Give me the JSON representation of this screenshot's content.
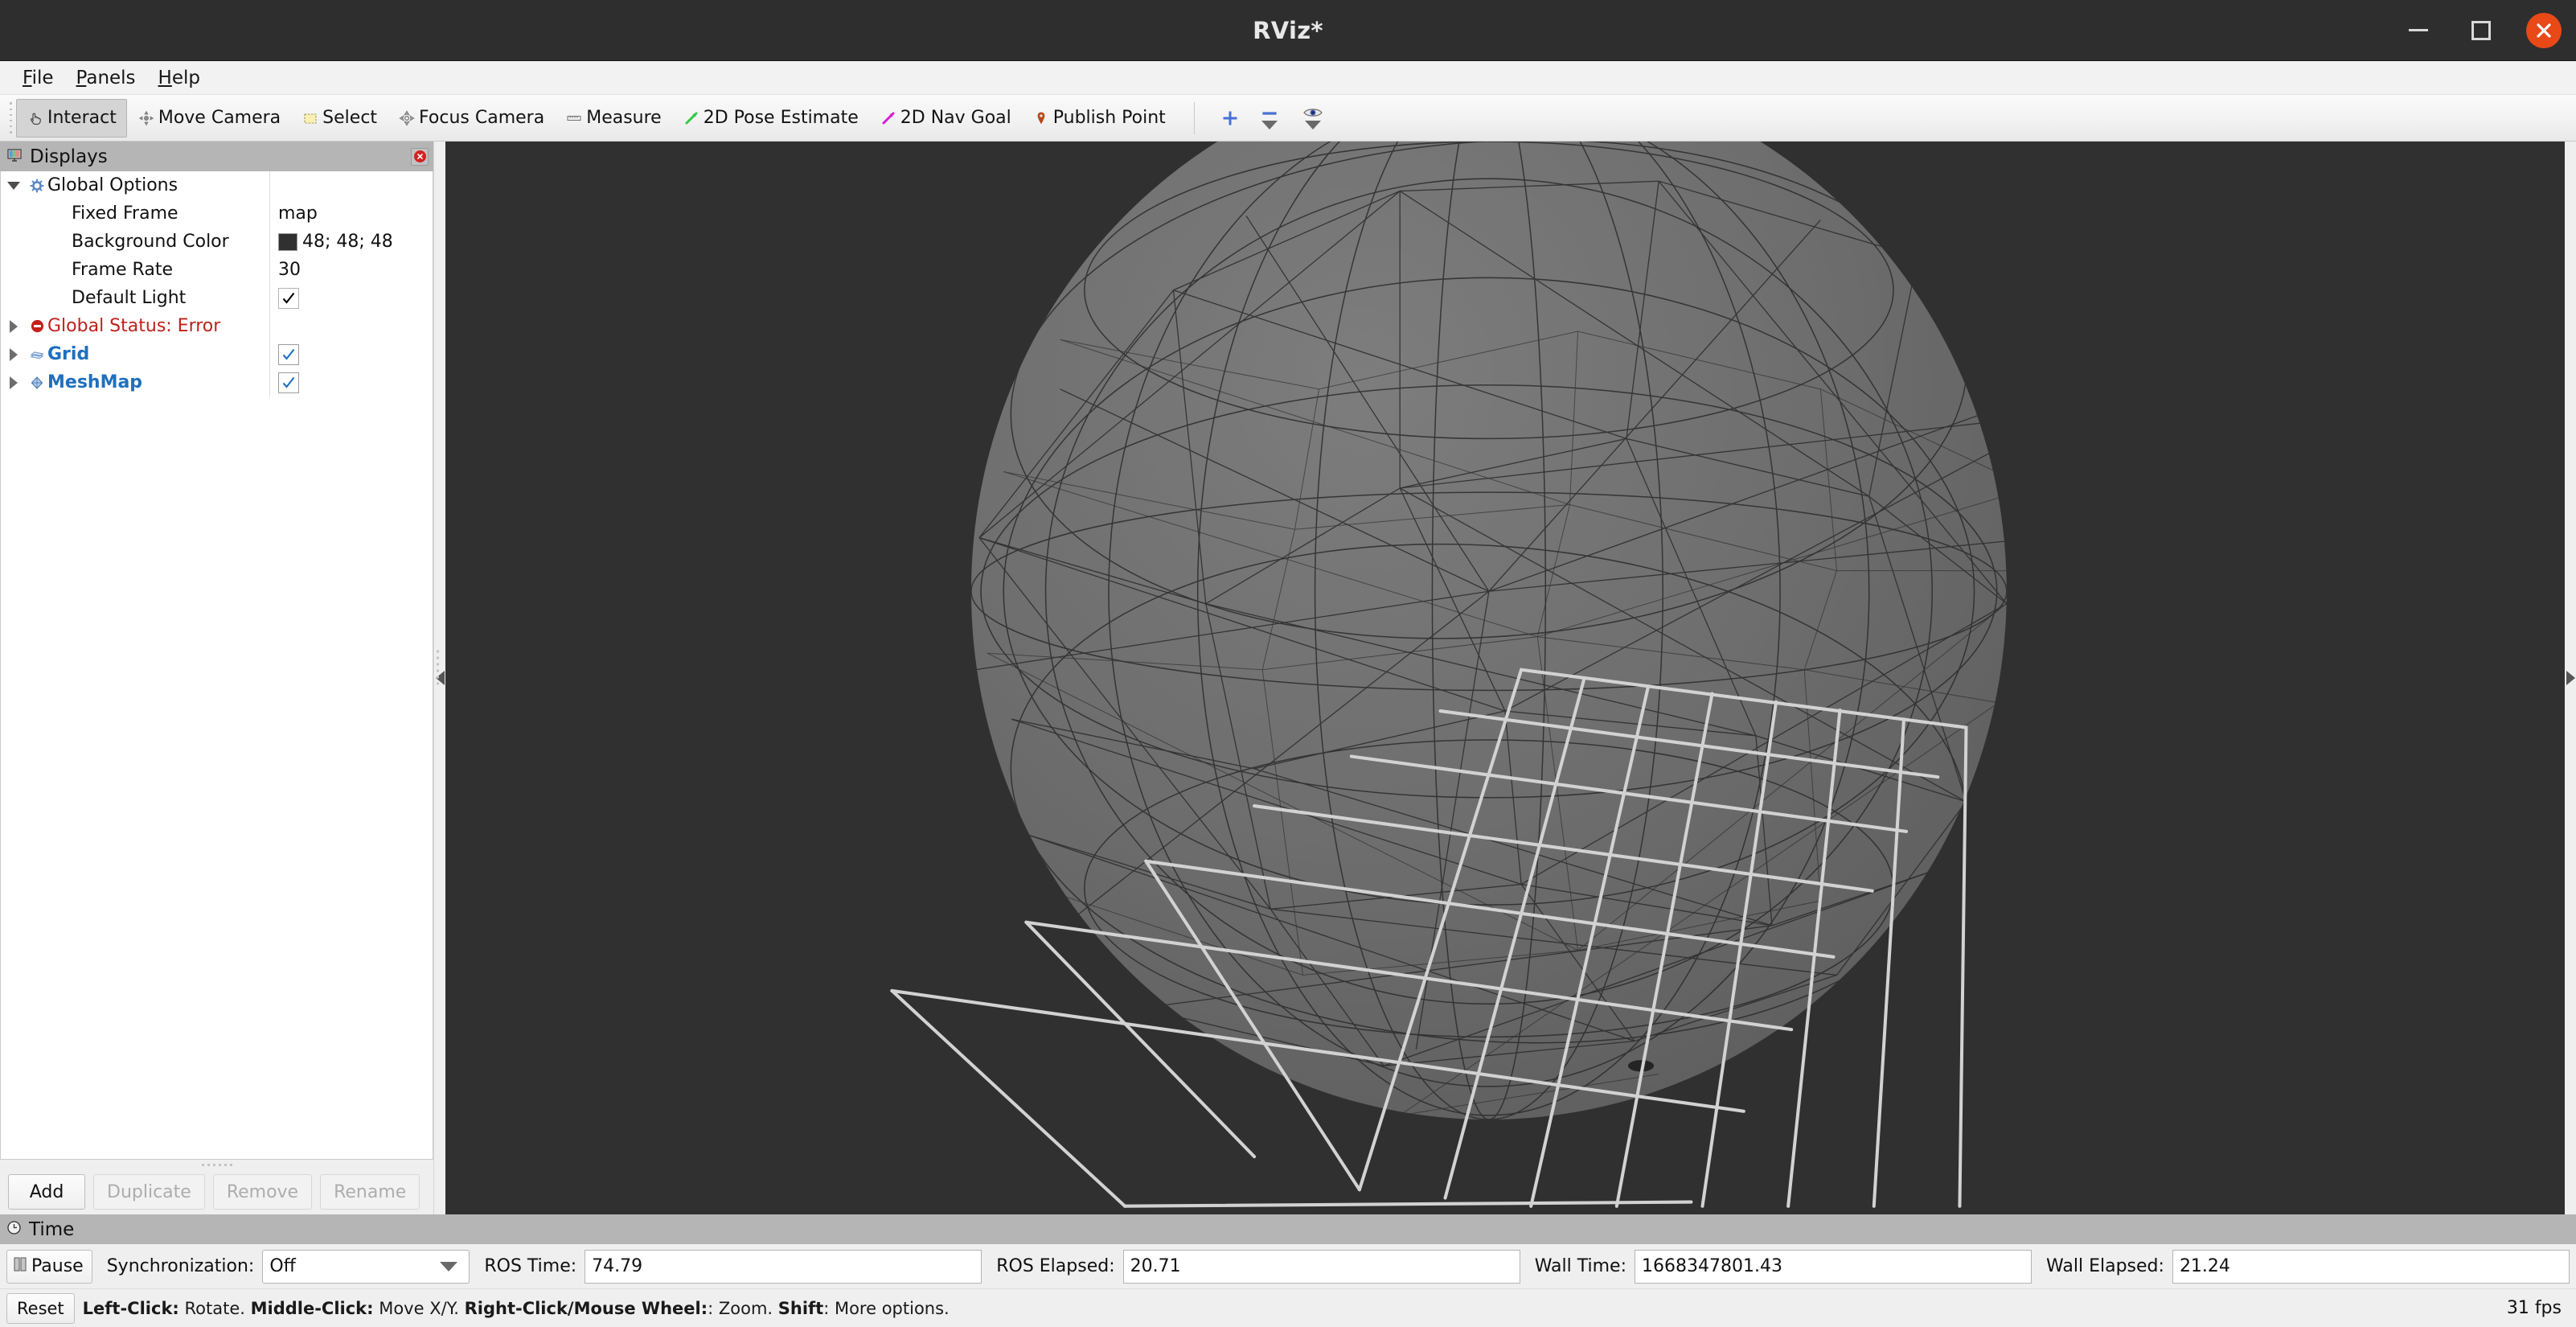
{
  "window": {
    "title": "RViz*",
    "controls": {
      "minimize": "minimize-button",
      "maximize": "maximize-button",
      "close": "close-button"
    },
    "titlebar_bg": "#2e2e2e",
    "close_bg": "#e84916"
  },
  "menubar": {
    "items": [
      {
        "label": "File",
        "mnemonic": "F"
      },
      {
        "label": "Panels",
        "mnemonic": "P"
      },
      {
        "label": "Help",
        "mnemonic": "H"
      }
    ]
  },
  "toolbar": {
    "tools": [
      {
        "label": "Interact",
        "icon": "hand-cursor-icon",
        "active": true
      },
      {
        "label": "Move Camera",
        "icon": "move-camera-icon",
        "active": false
      },
      {
        "label": "Select",
        "icon": "select-rect-icon",
        "active": false
      },
      {
        "label": "Focus Camera",
        "icon": "focus-camera-icon",
        "active": false
      },
      {
        "label": "Measure",
        "icon": "ruler-icon",
        "active": false
      },
      {
        "label": "2D Pose Estimate",
        "icon": "green-arrow-icon",
        "active": false
      },
      {
        "label": "2D Nav Goal",
        "icon": "magenta-arrow-icon",
        "active": false
      },
      {
        "label": "Publish Point",
        "icon": "map-pin-icon",
        "active": false
      }
    ],
    "extra_buttons": [
      {
        "name": "add-tool-icon",
        "icon": "plus-icon",
        "has_menu": false
      },
      {
        "name": "remove-tool-icon",
        "icon": "minus-icon",
        "has_menu": true
      },
      {
        "name": "visibility-icon",
        "icon": "eye-icon",
        "has_menu": true
      }
    ],
    "accent_green": "#2ecc40",
    "accent_magenta": "#d81bd8",
    "accent_blue": "#4a6fd4"
  },
  "displays": {
    "header_title": "Displays",
    "header_icon": "monitor-icon",
    "close_icon": "close-panel-icon",
    "tree": [
      {
        "label": "Global Options",
        "value": "",
        "icon": "gear-icon",
        "twisty": "down",
        "style": "normal",
        "indent": 0,
        "control": "none"
      },
      {
        "label": "Fixed Frame",
        "value": "map",
        "icon": "",
        "twisty": "none",
        "style": "normal",
        "indent": 1,
        "control": "text"
      },
      {
        "label": "Background Color",
        "value": "48; 48; 48",
        "icon": "",
        "twisty": "none",
        "style": "normal",
        "indent": 1,
        "control": "color",
        "swatch": "#303030"
      },
      {
        "label": "Frame Rate",
        "value": "30",
        "icon": "",
        "twisty": "none",
        "style": "normal",
        "indent": 1,
        "control": "text"
      },
      {
        "label": "Default Light",
        "value": "",
        "icon": "",
        "twisty": "none",
        "style": "normal",
        "indent": 1,
        "control": "checkbox-black"
      },
      {
        "label": "Global Status: Error",
        "value": "",
        "icon": "error-icon",
        "twisty": "right",
        "style": "error",
        "indent": 0,
        "control": "none"
      },
      {
        "label": "Grid",
        "value": "",
        "icon": "grid-icon",
        "twisty": "right",
        "style": "link",
        "indent": 0,
        "control": "checkbox-blue"
      },
      {
        "label": "MeshMap",
        "value": "",
        "icon": "mesh-icon",
        "twisty": "right",
        "style": "link",
        "indent": 0,
        "control": "checkbox-blue"
      }
    ],
    "buttons": [
      {
        "label": "Add",
        "enabled": true
      },
      {
        "label": "Duplicate",
        "enabled": false
      },
      {
        "label": "Remove",
        "enabled": false
      },
      {
        "label": "Rename",
        "enabled": false
      }
    ]
  },
  "viewport": {
    "background_color": "#303030",
    "mesh_fill": "#6e6e6e",
    "mesh_wire": "#2a2a2a",
    "grid_color": "#d2d2d2",
    "scene": "triangulated-sphere-mesh-over-perspective-grid"
  },
  "time": {
    "header_title": "Time",
    "header_icon": "clock-icon",
    "pause_label": "Pause",
    "pause_icon": "pause-icon",
    "sync_label": "Synchronization:",
    "sync_value": "Off",
    "fields": [
      {
        "label": "ROS Time:",
        "value": "74.79"
      },
      {
        "label": "ROS Elapsed:",
        "value": "20.71"
      },
      {
        "label": "Wall Time:",
        "value": "1668347801.43"
      },
      {
        "label": "Wall Elapsed:",
        "value": "21.24"
      }
    ]
  },
  "statusbar": {
    "reset_label": "Reset",
    "hints": [
      {
        "key": "Left-Click:",
        "text": " Rotate. "
      },
      {
        "key": "Middle-Click:",
        "text": " Move X/Y. "
      },
      {
        "key": "Right-Click/Mouse Wheel:",
        "text": ": Zoom. "
      },
      {
        "key": "Shift",
        "text": ": More options."
      }
    ],
    "fps": "31 fps"
  }
}
